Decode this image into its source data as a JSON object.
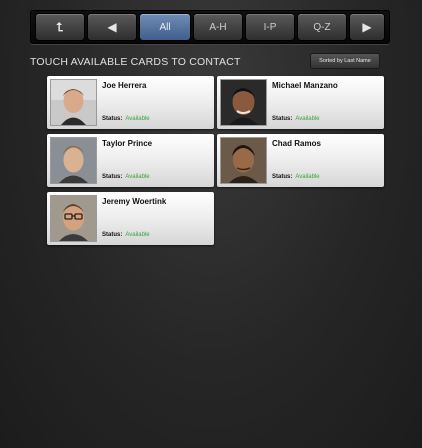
{
  "toolbar": {
    "back_glyph": "⮤",
    "prev_glyph": "◀",
    "next_glyph": "▶",
    "filters": [
      {
        "label": "All",
        "active": true
      },
      {
        "label": "A-H",
        "active": false
      },
      {
        "label": "I-P",
        "active": false
      },
      {
        "label": "Q-Z",
        "active": false
      }
    ]
  },
  "header": {
    "instruction": "TOUCH AVAILABLE CARDS TO CONTACT",
    "sort_label": "Sorted by Last Name"
  },
  "status_label": "Status:",
  "colors": {
    "accent": "#4f6f9e",
    "available": "#3aa33a"
  },
  "contacts": [
    {
      "name": "Joe Herrera",
      "status": "Available"
    },
    {
      "name": "Michael Manzano",
      "status": "Available"
    },
    {
      "name": "Taylor Prince",
      "status": "Available"
    },
    {
      "name": "Chad Ramos",
      "status": "Available"
    },
    {
      "name": "Jeremy Woertink",
      "status": "Available"
    }
  ]
}
